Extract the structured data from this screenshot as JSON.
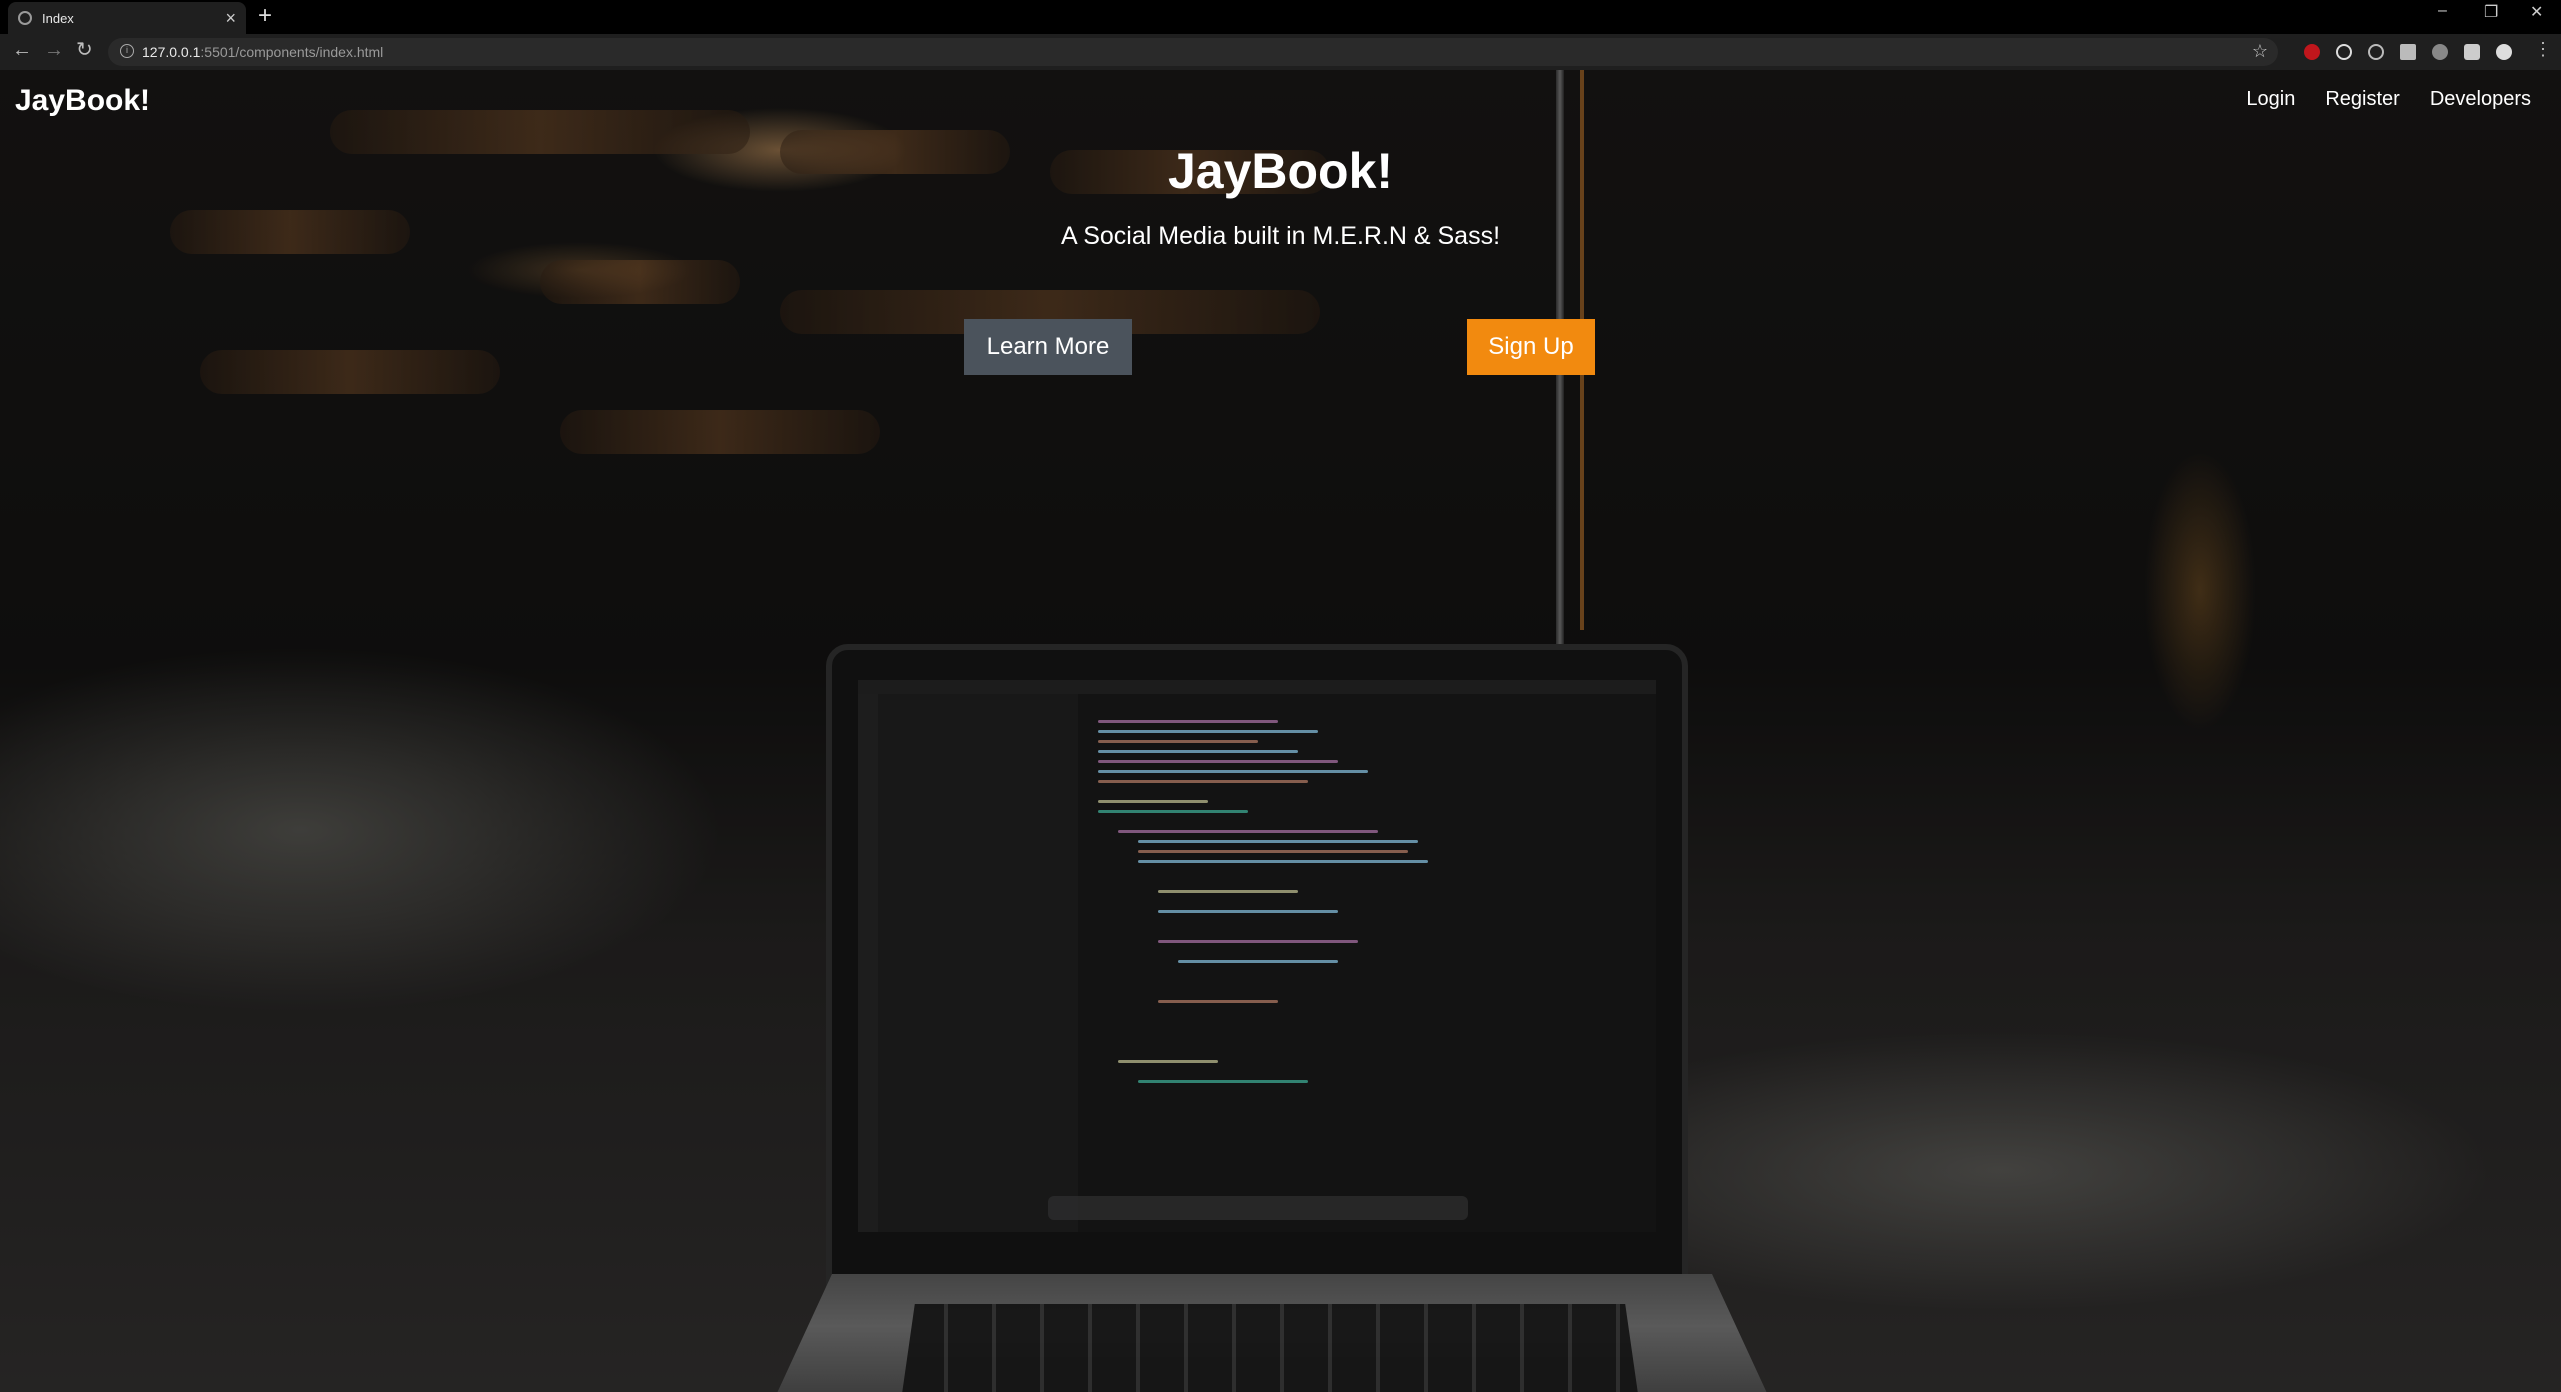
{
  "browser": {
    "tab_title": "Index",
    "tab_close": "×",
    "new_tab": "+",
    "url_host": "127.0.0.1",
    "url_path": ":5501/components/index.html",
    "window_controls": [
      "–",
      "❐",
      "✕"
    ],
    "nav_icons": [
      "back-icon",
      "forward-icon",
      "reload-icon"
    ],
    "extension_icons": [
      "ext-red-icon",
      "ext-gear-icon",
      "ext-circle-icon",
      "ext-screen-icon",
      "ext-globe-icon",
      "puzzle-icon",
      "profile-icon",
      "menu-icon"
    ]
  },
  "navbar": {
    "brand": "JayBook!",
    "links": [
      "Login",
      "Register",
      "Developers"
    ]
  },
  "hero": {
    "title": "JayBook!",
    "subtitle": "A Social Media built in M.E.R.N & Sass!",
    "learn_more": "Learn More",
    "sign_up": "Sign Up"
  },
  "colors": {
    "learn_more_bg": "#4b535c",
    "sign_up_bg": "#f28a0f",
    "text": "#ffffff"
  }
}
